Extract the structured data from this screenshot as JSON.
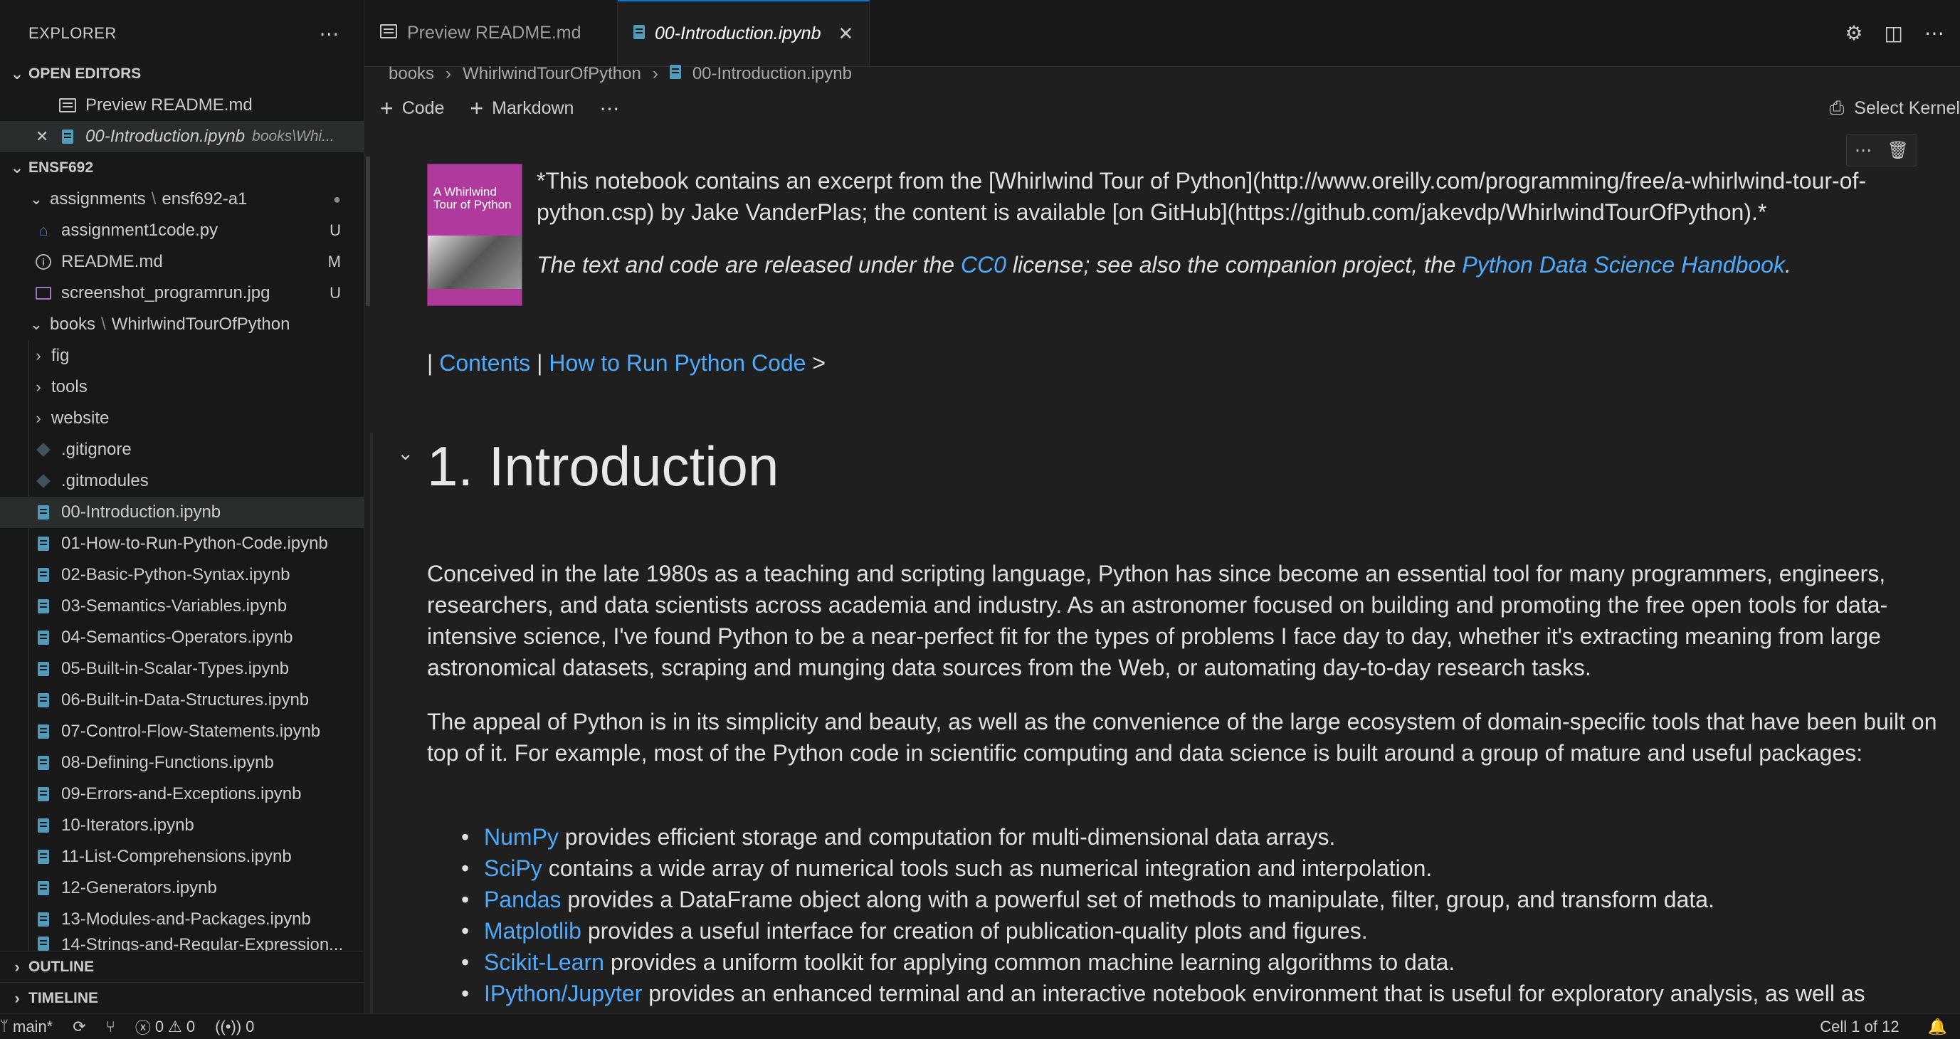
{
  "sidebar": {
    "title": "EXPLORER",
    "more": "⋯",
    "open_editors_label": "OPEN EDITORS",
    "open_editors": [
      {
        "name": "Preview README.md",
        "path": ""
      },
      {
        "name": "00-Introduction.ipynb",
        "path": "books\\Whi..."
      }
    ],
    "workspace_label": "ENSF692",
    "folder1": {
      "name": "assignments",
      "sep": "\\",
      "sub": "ensf692-a1",
      "status": "●"
    },
    "files1": [
      {
        "name": "assignment1code.py",
        "status": "U"
      },
      {
        "name": "README.md",
        "status": "M"
      },
      {
        "name": "screenshot_programrun.jpg",
        "status": "U"
      }
    ],
    "folder2": {
      "name": "books",
      "sep": "\\",
      "sub": "WhirlwindTourOfPython"
    },
    "subfolders": [
      "fig",
      "tools",
      "website"
    ],
    "dotfiles": [
      ".gitignore",
      ".gitmodules"
    ],
    "notebooks": [
      "00-Introduction.ipynb",
      "01-How-to-Run-Python-Code.ipynb",
      "02-Basic-Python-Syntax.ipynb",
      "03-Semantics-Variables.ipynb",
      "04-Semantics-Operators.ipynb",
      "05-Built-in-Scalar-Types.ipynb",
      "06-Built-in-Data-Structures.ipynb",
      "07-Control-Flow-Statements.ipynb",
      "08-Defining-Functions.ipynb",
      "09-Errors-and-Exceptions.ipynb",
      "10-Iterators.ipynb",
      "11-List-Comprehensions.ipynb",
      "12-Generators.ipynb",
      "13-Modules-and-Packages.ipynb",
      "14-Strings-and-Regular-Expression..."
    ],
    "outline_label": "OUTLINE",
    "timeline_label": "TIMELINE"
  },
  "tabs": [
    {
      "label": "Preview README.md"
    },
    {
      "label": "00-Introduction.ipynb",
      "close": "✕"
    }
  ],
  "breadcrumb": [
    "books",
    "WhirlwindTourOfPython",
    "00-Introduction.ipynb"
  ],
  "toolbar": {
    "code_label": "Code",
    "markdown_label": "Markdown",
    "more": "⋯",
    "kernel_label": "Select Kernel"
  },
  "cell_actions": {
    "more": "⋯",
    "delete": "🗑"
  },
  "notebook": {
    "cover": {
      "title": "A Whirlwind Tour of Python"
    },
    "para1": "*This notebook contains an excerpt from the [Whirlwind Tour of Python](http://www.oreilly.com/programming/free/a-whirlwind-tour-of-python.csp) by Jake VanderPlas; the content is available [on GitHub](https://github.com/jakevdp/WhirlwindTourOfPython).*",
    "para2_a": "The text and code are released under the ",
    "para2_cc0": "CC0",
    "para2_b": " license; see also the companion project, the ",
    "para2_handbook": "Python Data Science Handbook",
    "para2_c": ".",
    "nav_sep": "|",
    "nav_contents": "Contents",
    "nav_howto": "How to Run Python Code",
    "nav_gt": ">",
    "heading": "1. Introduction",
    "body1": "Conceived in the late 1980s as a teaching and scripting language, Python has since become an essential tool for many programmers, engineers, researchers, and data scientists across academia and industry. As an astronomer focused on building and promoting the free open tools for data-intensive science, I've found Python to be a near-perfect fit for the types of problems I face day to day, whether it's extracting meaning from large astronomical datasets, scraping and munging data sources from the Web, or automating day-to-day research tasks.",
    "body2": "The appeal of Python is in its simplicity and beauty, as well as the convenience of the large ecosystem of domain-specific tools that have been built on top of it. For example, most of the Python code in scientific computing and data science is built around a group of mature and useful packages:",
    "bullets": [
      {
        "link": "NumPy",
        "text": " provides efficient storage and computation for multi-dimensional data arrays."
      },
      {
        "link": "SciPy",
        "text": " contains a wide array of numerical tools such as numerical integration and interpolation."
      },
      {
        "link": "Pandas",
        "text": " provides a DataFrame object along with a powerful set of methods to manipulate, filter, group, and transform data."
      },
      {
        "link": "Matplotlib",
        "text": " provides a useful interface for creation of publication-quality plots and figures."
      },
      {
        "link": "Scikit-Learn",
        "text": " provides a uniform toolkit for applying common machine learning algorithms to data."
      },
      {
        "link": "IPython/Jupyter",
        "text": " provides an enhanced terminal and an interactive notebook environment that is useful for exploratory analysis, as well as"
      }
    ]
  },
  "statusbar": {
    "branch": "main*",
    "errors": "0",
    "warnings": "0",
    "ports": "0",
    "cell": "Cell 1 of 12"
  },
  "colors": {
    "link": "#4daafc",
    "accent": "#0078d4"
  }
}
